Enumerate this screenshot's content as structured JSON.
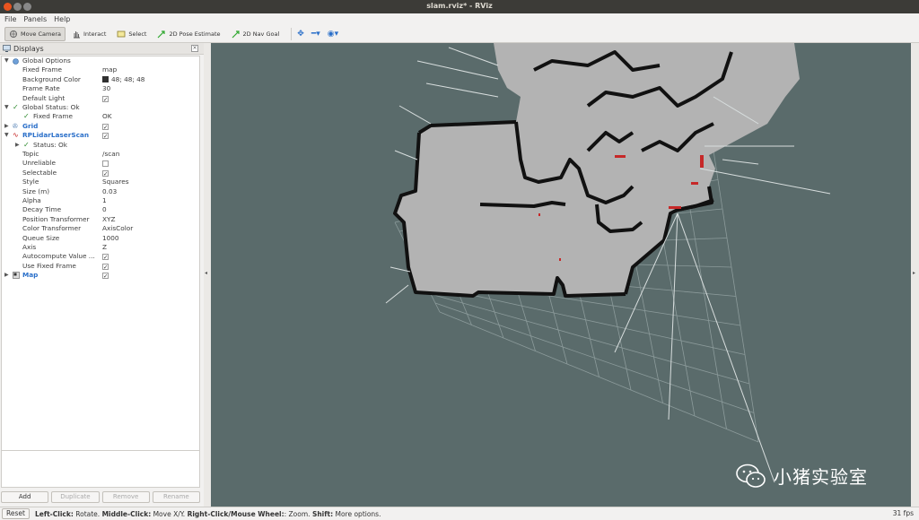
{
  "window": {
    "title": "slam.rviz* - RViz"
  },
  "menu": {
    "items": [
      "File",
      "Panels",
      "Help"
    ]
  },
  "toolbar": {
    "tools": [
      "Move Camera",
      "Interact",
      "Select",
      "2D Pose Estimate",
      "2D Nav Goal"
    ]
  },
  "displays": {
    "title": "Displays",
    "rows": [
      {
        "label": "Global Options",
        "value": ""
      },
      {
        "label": "Fixed Frame",
        "value": "map"
      },
      {
        "label": "Background Color",
        "value": "48; 48; 48"
      },
      {
        "label": "Frame Rate",
        "value": "30"
      },
      {
        "label": "Default Light",
        "value": ""
      },
      {
        "label": "Global Status: Ok",
        "value": ""
      },
      {
        "label": "Fixed Frame",
        "value": "OK"
      },
      {
        "label": "Grid",
        "value": ""
      },
      {
        "label": "RPLidarLaserScan",
        "value": ""
      },
      {
        "label": "Status: Ok",
        "value": ""
      },
      {
        "label": "Topic",
        "value": "/scan"
      },
      {
        "label": "Unreliable",
        "value": ""
      },
      {
        "label": "Selectable",
        "value": ""
      },
      {
        "label": "Style",
        "value": "Squares"
      },
      {
        "label": "Size (m)",
        "value": "0.03"
      },
      {
        "label": "Alpha",
        "value": "1"
      },
      {
        "label": "Decay Time",
        "value": "0"
      },
      {
        "label": "Position Transformer",
        "value": "XYZ"
      },
      {
        "label": "Color Transformer",
        "value": "AxisColor"
      },
      {
        "label": "Queue Size",
        "value": "1000"
      },
      {
        "label": "Axis",
        "value": "Z"
      },
      {
        "label": "Autocompute Value ...",
        "value": ""
      },
      {
        "label": "Use Fixed Frame",
        "value": ""
      },
      {
        "label": "Map",
        "value": ""
      }
    ],
    "buttons": {
      "add": "Add",
      "duplicate": "Duplicate",
      "remove": "Remove",
      "rename": "Rename"
    }
  },
  "status": {
    "reset": "Reset",
    "hint_left_key": "Left-Click:",
    "hint_left_val": " Rotate. ",
    "hint_mid_key": "Middle-Click:",
    "hint_mid_val": " Move X/Y. ",
    "hint_right_key": "Right-Click/Mouse Wheel:",
    "hint_right_val": ": Zoom. ",
    "hint_shift_key": "Shift:",
    "hint_shift_val": " More options.",
    "fps": "31 fps"
  },
  "watermark": {
    "text": "小猪实验室"
  },
  "colors": {
    "viewport_bg": "#5a6b6b",
    "map_free": "#b3b3b3",
    "link_blue": "#2a6fc9"
  }
}
